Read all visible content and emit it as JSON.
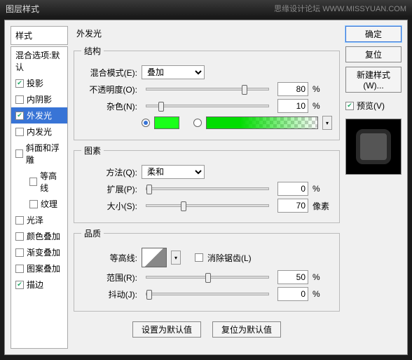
{
  "titlebar": {
    "title": "图层样式",
    "watermark": "思缘设计论坛 WWW.MISSYUAN.COM"
  },
  "sidebar": {
    "header": "样式",
    "items": [
      {
        "label": "混合选项:默认",
        "check": false,
        "showCheck": false
      },
      {
        "label": "投影",
        "check": true,
        "showCheck": true
      },
      {
        "label": "内阴影",
        "check": false,
        "showCheck": true
      },
      {
        "label": "外发光",
        "check": true,
        "showCheck": true,
        "selected": true
      },
      {
        "label": "内发光",
        "check": false,
        "showCheck": true
      },
      {
        "label": "斜面和浮雕",
        "check": false,
        "showCheck": true
      },
      {
        "label": "等高线",
        "check": false,
        "showCheck": true,
        "indent": true
      },
      {
        "label": "纹理",
        "check": false,
        "showCheck": true,
        "indent": true
      },
      {
        "label": "光泽",
        "check": false,
        "showCheck": true
      },
      {
        "label": "颜色叠加",
        "check": false,
        "showCheck": true
      },
      {
        "label": "渐变叠加",
        "check": false,
        "showCheck": true
      },
      {
        "label": "图案叠加",
        "check": false,
        "showCheck": true
      },
      {
        "label": "描边",
        "check": true,
        "showCheck": true
      }
    ]
  },
  "main": {
    "title": "外发光",
    "structure": {
      "legend": "结构",
      "blendMode": {
        "label": "混合模式(E):",
        "value": "叠加"
      },
      "opacity": {
        "label": "不透明度(O):",
        "value": "80",
        "unit": "%",
        "pos": 78
      },
      "noise": {
        "label": "杂色(N):",
        "value": "10",
        "unit": "%",
        "pos": 10
      },
      "colorRadio": true,
      "gradientRadio": false
    },
    "elements": {
      "legend": "图素",
      "technique": {
        "label": "方法(Q):",
        "value": "柔和"
      },
      "spread": {
        "label": "扩展(P):",
        "value": "0",
        "unit": "%",
        "pos": 0
      },
      "size": {
        "label": "大小(S):",
        "value": "70",
        "unit": "像素",
        "pos": 28
      }
    },
    "quality": {
      "legend": "品质",
      "contour": {
        "label": "等高线:"
      },
      "antialias": {
        "label": "消除锯齿(L)",
        "check": false
      },
      "range": {
        "label": "范围(R):",
        "value": "50",
        "unit": "%",
        "pos": 48
      },
      "jitter": {
        "label": "抖动(J):",
        "value": "0",
        "unit": "%",
        "pos": 0
      }
    },
    "buttons": {
      "default": "设置为默认值",
      "reset": "复位为默认值"
    }
  },
  "right": {
    "ok": "确定",
    "cancel": "复位",
    "newStyle": "新建样式(W)...",
    "preview": {
      "label": "预览(V)",
      "check": true
    }
  }
}
